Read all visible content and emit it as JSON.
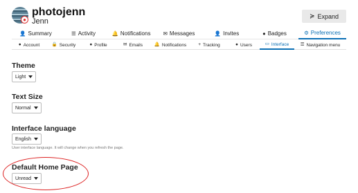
{
  "user": {
    "username": "photojenn",
    "full_name": "Jenn"
  },
  "header": {
    "expand_label": "Expand",
    "expand_icon": "chevrons-down-icon"
  },
  "primary_nav": [
    {
      "label": "Summary",
      "icon": "user-icon",
      "glyph": "👤"
    },
    {
      "label": "Activity",
      "icon": "list-icon",
      "glyph": "☰"
    },
    {
      "label": "Notifications",
      "icon": "bell-icon",
      "glyph": "🔔"
    },
    {
      "label": "Messages",
      "icon": "envelope-icon",
      "glyph": "✉"
    },
    {
      "label": "Invites",
      "icon": "user-plus-icon",
      "glyph": "👤"
    },
    {
      "label": "Badges",
      "icon": "certificate-icon",
      "glyph": "●"
    },
    {
      "label": "Preferences",
      "icon": "cog-icon",
      "glyph": "⚙",
      "active": true
    }
  ],
  "secondary_nav": [
    {
      "label": "Account",
      "icon": "user-icon",
      "glyph": "●"
    },
    {
      "label": "Security",
      "icon": "lock-icon",
      "glyph": "🔒"
    },
    {
      "label": "Profile",
      "icon": "user-icon",
      "glyph": "●"
    },
    {
      "label": "Emails",
      "icon": "envelope-icon",
      "glyph": "✉"
    },
    {
      "label": "Notifications",
      "icon": "bell-icon",
      "glyph": "🔔"
    },
    {
      "label": "Tracking",
      "icon": "plus-icon",
      "glyph": "+"
    },
    {
      "label": "Users",
      "icon": "users-icon",
      "glyph": "●"
    },
    {
      "label": "Interface",
      "icon": "desktop-icon",
      "glyph": "▭",
      "active": true
    },
    {
      "label": "Navigation menu",
      "icon": "bars-icon",
      "glyph": "☰"
    }
  ],
  "fields": {
    "theme": {
      "label": "Theme",
      "value": "Light"
    },
    "text_size": {
      "label": "Text Size",
      "value": "Normal"
    },
    "interface_language": {
      "label": "Interface language",
      "value": "English",
      "help": "User interface language. It will change when you refresh the page."
    },
    "default_home_page": {
      "label": "Default Home Page",
      "value": "Unread"
    }
  },
  "colors": {
    "accent": "#0a6fb5",
    "highlight": "#d22222"
  }
}
